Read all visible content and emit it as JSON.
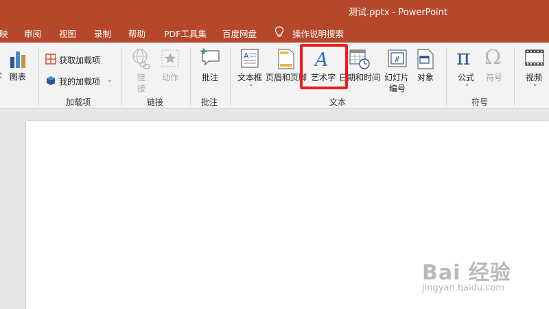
{
  "window": {
    "title": "测试.pptx  -  PowerPoint"
  },
  "tabs": [
    "映",
    "审阅",
    "视图",
    "录制",
    "帮助",
    "PDF工具集",
    "百度网盘",
    "操作说明搜索"
  ],
  "ribbon": {
    "chart": {
      "label": "图表"
    },
    "addins": {
      "get": "获取加载项",
      "mine": "我的加载项",
      "group": "加载项"
    },
    "links": {
      "link_line1": "链",
      "link_line2": "接",
      "action": "动作",
      "group": "链接"
    },
    "comments": {
      "comment": "批注",
      "group": "批注"
    },
    "text": {
      "textbox": "文本框",
      "header_footer": "页眉和页脚",
      "wordart": "艺术字",
      "datetime": "日期和时间",
      "slide_number_line1": "幻灯片",
      "slide_number_line2": "编号",
      "object": "对象",
      "group": "文本"
    },
    "symbols": {
      "equation": "公式",
      "symbol": "符号",
      "group": "符号"
    },
    "media": {
      "video": "视频"
    }
  },
  "watermark": {
    "line1": "Bai  经验",
    "line2": "jingyan.baidu.com"
  },
  "colors": {
    "accent": "#b7472a",
    "highlight": "#ee1c1c",
    "icon_blue": "#2b579a"
  }
}
